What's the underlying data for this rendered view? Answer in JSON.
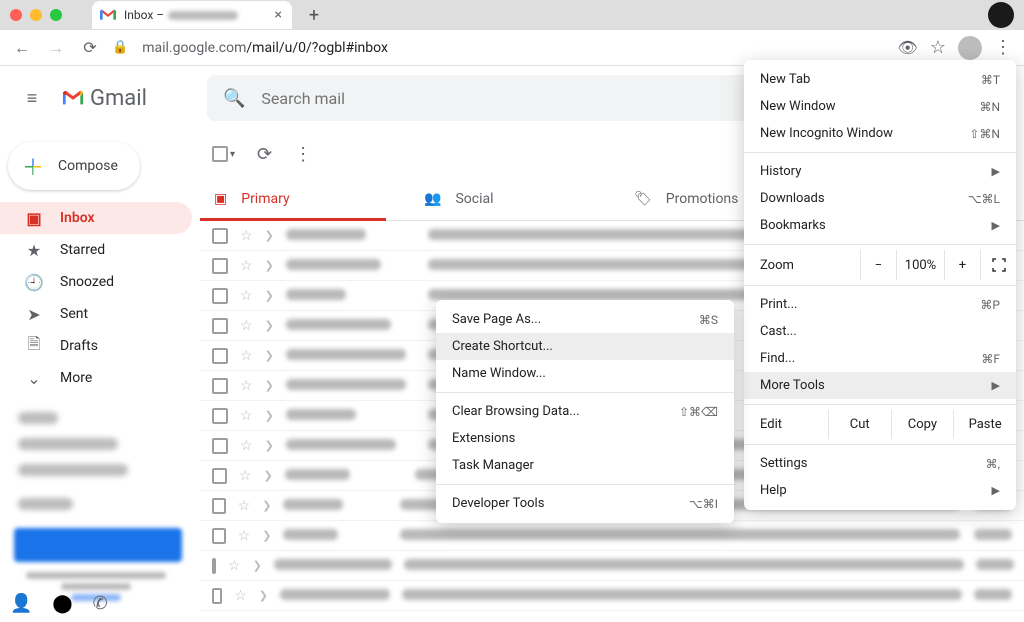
{
  "browser_tab": {
    "title": "Inbox –",
    "close": "×",
    "plus": "+"
  },
  "addressbar": {
    "back": "←",
    "forward": "→",
    "reload": "⟳",
    "lock": "🔒",
    "prefix": "mail.google.com",
    "path": "/mail/u/0/?ogbl#inbox",
    "eye": "👁",
    "star": "☆",
    "dots": "⋮"
  },
  "gmail": {
    "hamburger": "≡",
    "brand": "Gmail",
    "search_placeholder": "Search mail",
    "compose": "Compose",
    "nav": {
      "inbox": "Inbox",
      "starred": "Starred",
      "snoozed": "Snoozed",
      "sent": "Sent",
      "drafts": "Drafts",
      "more": "More"
    },
    "tabs": {
      "primary": "Primary",
      "social": "Social",
      "promotions": "Promotions"
    },
    "toolbar": {
      "refresh": "⟳",
      "more": "⋮",
      "caret": "▾"
    },
    "footer": {
      "person": "👤",
      "chat": "🗨",
      "phone": "📞"
    }
  },
  "chrome_menu": {
    "new_tab": {
      "label": "New Tab",
      "shortcut": "⌘T"
    },
    "new_window": {
      "label": "New Window",
      "shortcut": "⌘N"
    },
    "new_incognito": {
      "label": "New Incognito Window",
      "shortcut": "⇧⌘N"
    },
    "history": {
      "label": "History"
    },
    "downloads": {
      "label": "Downloads",
      "shortcut": "⌥⌘L"
    },
    "bookmarks": {
      "label": "Bookmarks"
    },
    "zoom": {
      "label": "Zoom",
      "value": "100%",
      "minus": "−",
      "plus": "+"
    },
    "print": {
      "label": "Print...",
      "shortcut": "⌘P"
    },
    "cast": {
      "label": "Cast..."
    },
    "find": {
      "label": "Find...",
      "shortcut": "⌘F"
    },
    "more_tools": {
      "label": "More Tools"
    },
    "edit": {
      "label": "Edit",
      "cut": "Cut",
      "copy": "Copy",
      "paste": "Paste"
    },
    "settings": {
      "label": "Settings",
      "shortcut": "⌘,"
    },
    "help": {
      "label": "Help"
    }
  },
  "tools_menu": {
    "save_page": {
      "label": "Save Page As...",
      "shortcut": "⌘S"
    },
    "create_shortcut": {
      "label": "Create Shortcut..."
    },
    "name_window": {
      "label": "Name Window..."
    },
    "clear_data": {
      "label": "Clear Browsing Data...",
      "shortcut": "⇧⌘⌫"
    },
    "extensions": {
      "label": "Extensions"
    },
    "task_manager": {
      "label": "Task Manager"
    },
    "dev_tools": {
      "label": "Developer Tools",
      "shortcut": "⌥⌘I"
    }
  }
}
